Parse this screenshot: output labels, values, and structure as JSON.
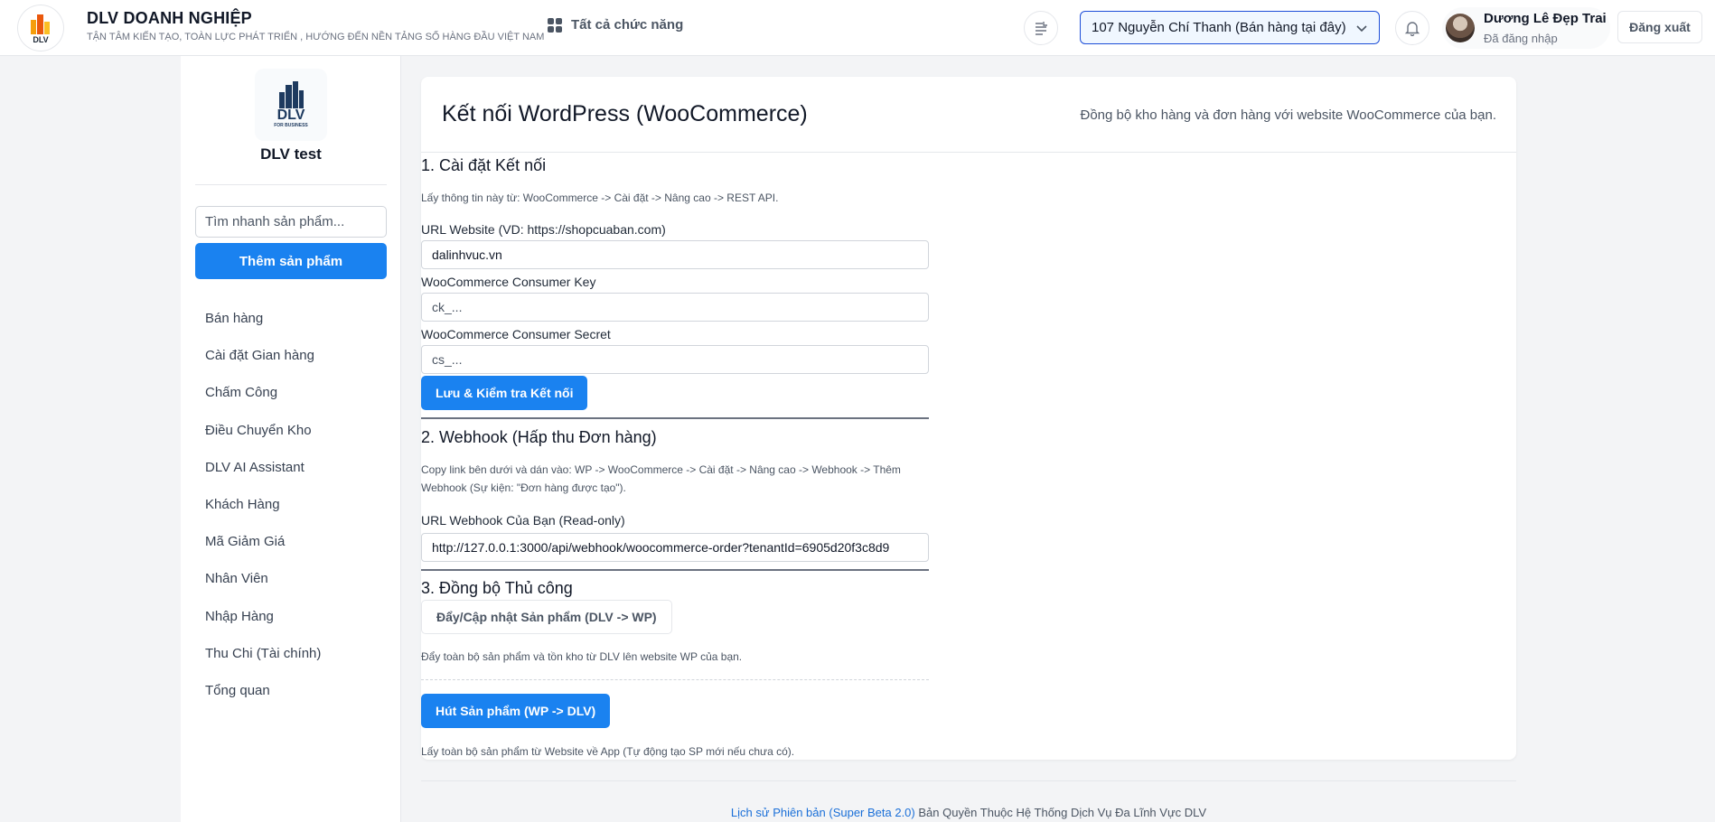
{
  "header": {
    "brand_title": "DLV DOANH NGHIỆP",
    "brand_tagline": "TẬN TÂM KIẾN TẠO, TOÀN LỰC PHÁT TRIỂN , HƯỚNG ĐẾN NỀN TẢNG SỐ HÀNG ĐẦU VIỆT NAM",
    "logo_text": "DLV",
    "all_functions": "Tất cả chức năng",
    "store_selected": "107 Nguyễn Chí Thanh (Bán hàng tại đây)",
    "user_name": "Dương Lê Đẹp Trai",
    "user_status": "Đã đăng nhập",
    "logout": "Đăng xuất"
  },
  "sidebar": {
    "logo_text": "DLV",
    "logo_sub": "FOR BUSINESS",
    "shop_name": "DLV test",
    "search_placeholder": "Tìm nhanh sản phẩm...",
    "add_product": "Thêm sản phẩm",
    "items": [
      {
        "label": "Bán hàng"
      },
      {
        "label": "Cài đặt Gian hàng"
      },
      {
        "label": "Chấm Công"
      },
      {
        "label": "Điều Chuyển Kho"
      },
      {
        "label": "DLV AI Assistant"
      },
      {
        "label": "Khách Hàng"
      },
      {
        "label": "Mã Giảm Giá"
      },
      {
        "label": "Nhân Viên"
      },
      {
        "label": "Nhập Hàng"
      },
      {
        "label": "Thu Chi (Tài chính)"
      },
      {
        "label": "Tổng quan"
      }
    ]
  },
  "main": {
    "title": "Kết nối WordPress (WooCommerce)",
    "subtitle": "Đồng bộ kho hàng và đơn hàng với website WooCommerce của bạn.",
    "section1": {
      "heading": "1. Cài đặt Kết nối",
      "hint": "Lấy thông tin này từ: WooCommerce -> Cài đặt -> Nâng cao -> REST API.",
      "url_label": "URL Website (VD: https://shopcuaban.com)",
      "url_value": "dalinhvuc.vn",
      "key_label": "WooCommerce Consumer Key",
      "key_placeholder": "ck_...",
      "secret_label": "WooCommerce Consumer Secret",
      "secret_placeholder": "cs_...",
      "save_button": "Lưu & Kiểm tra Kết nối"
    },
    "section2": {
      "heading": "2. Webhook (Hấp thu Đơn hàng)",
      "hint": "Copy link bên dưới và dán vào: WP -> WooCommerce -> Cài đặt -> Nâng cao -> Webhook -> Thêm Webhook (Sự kiện: \"Đơn hàng được tạo\").",
      "webhook_label": "URL Webhook Của Bạn (Read-only)",
      "webhook_value": "http://127.0.0.1:3000/api/webhook/woocommerce-order?tenantId=6905d20f3c8d9"
    },
    "section3": {
      "heading": "3. Đồng bộ Thủ công",
      "push_button": "Đẩy/Cập nhật Sản phẩm (DLV -> WP)",
      "push_hint": "Đẩy toàn bộ sản phẩm và tồn kho từ DLV lên website WP của bạn.",
      "pull_button": "Hút Sản phẩm (WP -> DLV)",
      "pull_hint": "Lấy toàn bộ sản phẩm từ Website về App (Tự động tạo SP mới nếu chưa có)."
    }
  },
  "footer": {
    "link": "Lịch sử Phiên bản (Super Beta 2.0)",
    "text": " Bản Quyền Thuộc Hệ Thống Dịch Vụ Đa Lĩnh Vực DLV"
  },
  "colors": {
    "primary": "#1a82f0",
    "store_border": "#1d4ed8"
  }
}
